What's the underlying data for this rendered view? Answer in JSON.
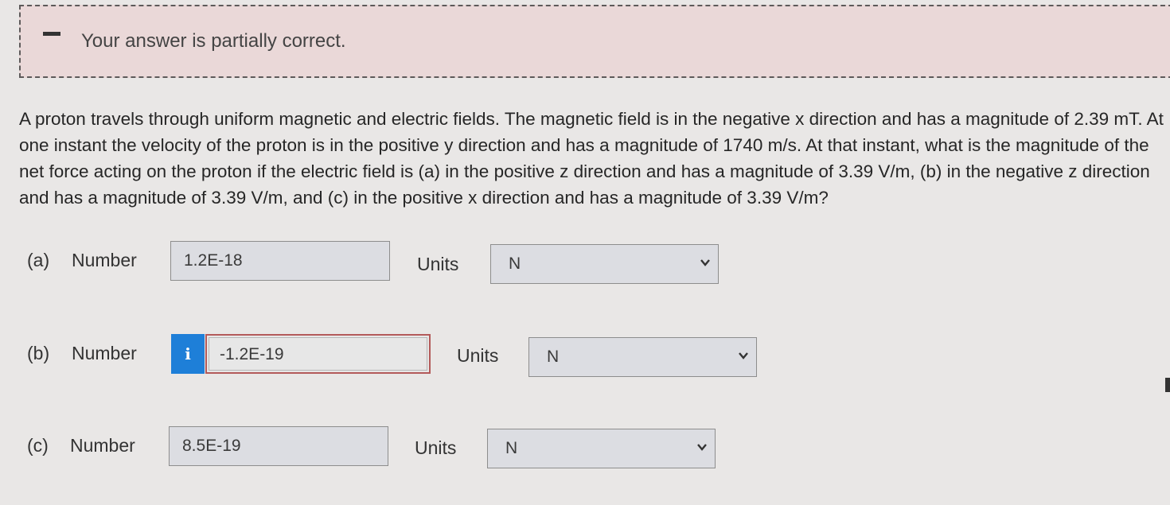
{
  "feedback": {
    "message": "Your answer is partially correct."
  },
  "question": {
    "text": "A proton travels through uniform magnetic and electric fields. The magnetic field is in the negative x direction and has a magnitude of 2.39 mT. At one instant the velocity of the proton is in the positive y direction and has a magnitude of 1740 m/s. At that instant, what is the magnitude of the net force acting on the proton if the electric field is (a) in the positive z direction and has a magnitude of 3.39 V/m, (b) in the negative z direction and has a magnitude of 3.39 V/m, and (c) in the positive x direction and has a magnitude of 3.39 V/m?"
  },
  "parts": [
    {
      "label": "(a)",
      "number_label": "Number",
      "value": "1.2E-18",
      "units_label": "Units",
      "unit": "N",
      "status": "correct"
    },
    {
      "label": "(b)",
      "number_label": "Number",
      "value": "-1.2E-19",
      "units_label": "Units",
      "unit": "N",
      "status": "incorrect",
      "info_icon": "i"
    },
    {
      "label": "(c)",
      "number_label": "Number",
      "value": "8.5E-19",
      "units_label": "Units",
      "unit": "N",
      "status": "correct"
    }
  ],
  "colors": {
    "info_button": "#1e7fd8",
    "feedback_bg": "#ead8d8",
    "wrong_border": "#b35a5a"
  }
}
